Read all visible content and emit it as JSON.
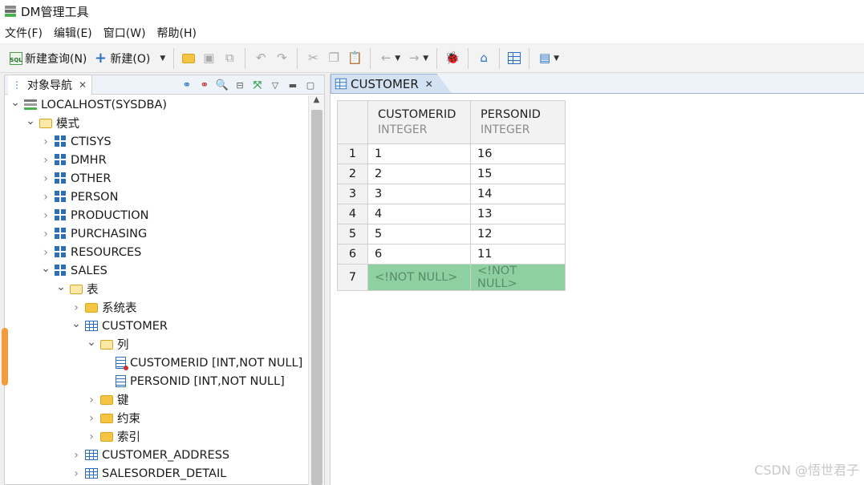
{
  "window": {
    "title": "DM管理工具"
  },
  "menu": [
    "文件(F)",
    "编辑(E)",
    "窗口(W)",
    "帮助(H)"
  ],
  "toolbar": {
    "new_query": "新建查询(N)",
    "new": "新建(O)"
  },
  "navigator": {
    "tab_label": "对象导航",
    "tree": [
      {
        "label": "LOCALHOST(SYSDBA)",
        "depth": 0,
        "icon": "server-icon",
        "expanded": true
      },
      {
        "label": "模式",
        "depth": 1,
        "icon": "folder-open-icon",
        "expanded": true
      },
      {
        "label": "CTISYS",
        "depth": 2,
        "icon": "schema-icon",
        "expanded": false
      },
      {
        "label": "DMHR",
        "depth": 2,
        "icon": "schema-icon",
        "expanded": false
      },
      {
        "label": "OTHER",
        "depth": 2,
        "icon": "schema-icon",
        "expanded": false
      },
      {
        "label": "PERSON",
        "depth": 2,
        "icon": "schema-icon",
        "expanded": false
      },
      {
        "label": "PRODUCTION",
        "depth": 2,
        "icon": "schema-icon",
        "expanded": false
      },
      {
        "label": "PURCHASING",
        "depth": 2,
        "icon": "schema-icon",
        "expanded": false
      },
      {
        "label": "RESOURCES",
        "depth": 2,
        "icon": "schema-icon",
        "expanded": false
      },
      {
        "label": "SALES",
        "depth": 2,
        "icon": "schema-icon",
        "expanded": true
      },
      {
        "label": "表",
        "depth": 3,
        "icon": "folder-open-icon",
        "expanded": true
      },
      {
        "label": "系统表",
        "depth": 4,
        "icon": "folder-icon",
        "expanded": false
      },
      {
        "label": "CUSTOMER",
        "depth": 4,
        "icon": "table-icon",
        "expanded": true
      },
      {
        "label": "列",
        "depth": 5,
        "icon": "folder-open-icon",
        "expanded": true
      },
      {
        "label": "CUSTOMERID [INT,NOT NULL]",
        "depth": 6,
        "icon": "primary-key-column-icon",
        "expanded": null
      },
      {
        "label": "PERSONID [INT,NOT NULL]",
        "depth": 6,
        "icon": "column-icon",
        "expanded": null
      },
      {
        "label": "键",
        "depth": 5,
        "icon": "folder-icon",
        "expanded": false
      },
      {
        "label": "约束",
        "depth": 5,
        "icon": "folder-icon",
        "expanded": false
      },
      {
        "label": "索引",
        "depth": 5,
        "icon": "folder-icon",
        "expanded": false
      },
      {
        "label": "CUSTOMER_ADDRESS",
        "depth": 4,
        "icon": "table-icon",
        "expanded": false
      },
      {
        "label": "SALESORDER_DETAIL",
        "depth": 4,
        "icon": "table-icon",
        "expanded": false
      }
    ]
  },
  "editor": {
    "tab_label": "CUSTOMER",
    "columns": [
      {
        "name": "CUSTOMERID",
        "type": "INTEGER"
      },
      {
        "name": "PERSONID",
        "type": "INTEGER"
      }
    ],
    "rows": [
      {
        "num": "1",
        "cells": [
          "1",
          "16"
        ]
      },
      {
        "num": "2",
        "cells": [
          "2",
          "15"
        ]
      },
      {
        "num": "3",
        "cells": [
          "3",
          "14"
        ]
      },
      {
        "num": "4",
        "cells": [
          "4",
          "13"
        ]
      },
      {
        "num": "5",
        "cells": [
          "5",
          "12"
        ]
      },
      {
        "num": "6",
        "cells": [
          "6",
          "11"
        ]
      }
    ],
    "new_row": {
      "num": "7",
      "cells": [
        "<!NOT NULL>",
        "<!NOT NULL>"
      ]
    }
  },
  "watermark": "CSDN @悟世君子",
  "colors": {
    "new_row_bg": "#8ed0a0",
    "tab_active_bg": "#d3e2f3",
    "accent_blue": "#2c6fb8"
  }
}
